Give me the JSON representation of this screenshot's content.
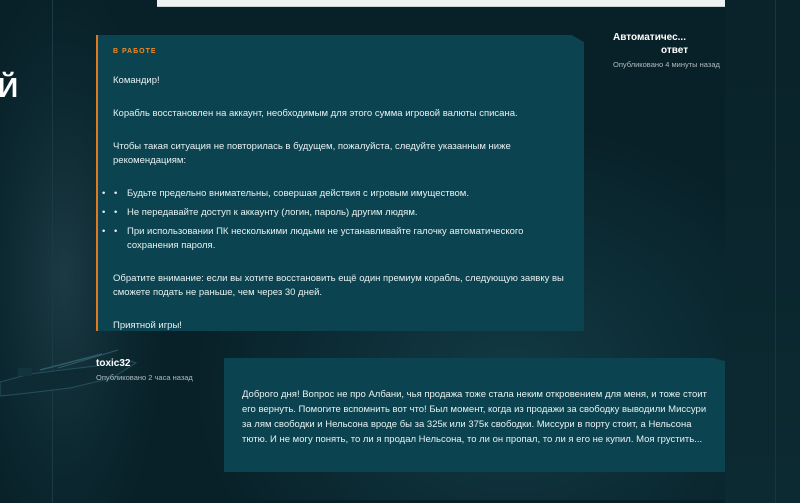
{
  "hero": {
    "glyph": "Й"
  },
  "support_message": {
    "status": "В РАБОТЕ",
    "greeting": "Командир!",
    "paragraph1": "Корабль восстановлен на аккаунт, необходимым для этого сумма игровой валюты списана.",
    "paragraph2": "Чтобы такая ситуация не повторилась в будущем, пожалуйста, следуйте указанным ниже рекомендациям:",
    "recommendations": [
      "Будьте предельно внимательны, совершая действия с игровым имуществом.",
      "Не передавайте доступ к аккаунту (логин, пароль) другим людям.",
      "При использовании ПК несколькими людьми не устанавливайте галочку автоматического сохранения пароля."
    ],
    "note": "Обратите внимание: если вы хотите восстановить ещё один премиум корабль, следующую заявку вы сможете подать не раньше, чем через 30 дней.",
    "closing": "Приятной игры!",
    "author_line1": "Автоматичес...",
    "author_line2": "ответ",
    "published": "Опубликовано 4 минуты назад"
  },
  "user_message": {
    "author": "toxic32",
    "published": "Опубликовано 2 часа назад",
    "text": "Доброго дня! Вопрос не про Албани, чья продажа тоже стала неким откровением для меня, и тоже стоит его вернуть. Помогите вспомнить вот что! Был момент, когда из продажи за свободку выводили Миссури за лям свободки и Нельсона вроде бы за 325к или 375к свободки. Миссури в порту стоит, а Нельсона тютю. И не могу понять, то ли я продал Нельсона, то ли он пропал, то ли я его не купил. Моя грустить..."
  },
  "colors": {
    "accent": "#e07a20",
    "card": "#0b4450",
    "background": "#082028"
  }
}
